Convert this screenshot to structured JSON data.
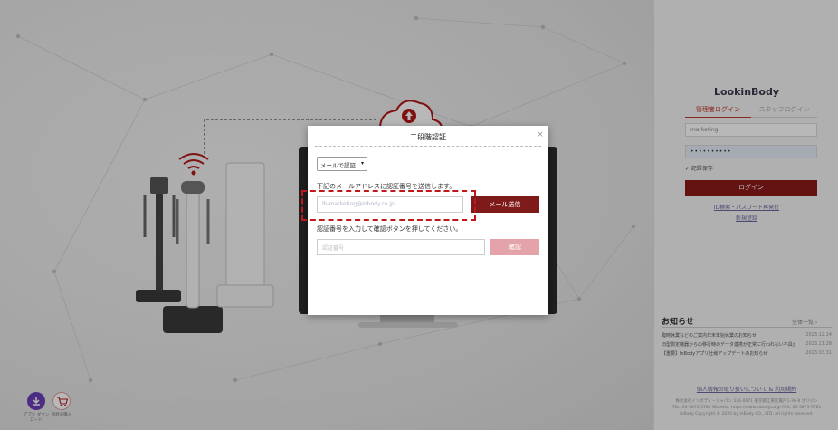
{
  "modal": {
    "title": "二段階認証",
    "close_symbol": "×",
    "method_select_value": "メールで認証",
    "method_chevron": "▾",
    "instruction_send": "下記のメールアドレスに認証番号を送信します。",
    "email_value": "lb-marketing@inbody.co.jp",
    "send_button": "メール送信",
    "instruction_code": "認証番号を入力して確認ボタンを押してください。",
    "code_placeholder": "認証番号",
    "confirm_button": "確認"
  },
  "login_panel": {
    "title": "LookinBody",
    "tab_member": "管理者ログイン",
    "tab_staff": "スタッフログイン",
    "id_value": "marketing",
    "password_value": "••••••••••",
    "remember_label": "✓ 記録保存",
    "login_button": "ログイン",
    "forgot_link": "ID検索・パスワード再発行",
    "signup_link": "新規登録"
  },
  "news": {
    "title": "お知らせ",
    "all_link": "全体一覧 ›",
    "items": [
      {
        "text": "臨時休業などのご案内年末年始休業のお知らせ",
        "date": "2023.12.14"
      },
      {
        "text": "旧型測定機器からの移行時のデータ連携が正常に行われない不具合の…",
        "date": "2023.11.28"
      },
      {
        "text": "【重要】InBodyアプリ仕様アップデートのお知らせ",
        "date": "2023.03.31"
      }
    ]
  },
  "footer": {
    "privacy_link": "個人情報の取り扱いについて & 利用規約",
    "company_line": "株式会社インボディ・ジャパン 136-0071 東京都江東区亀戸1-36-8 オリジン",
    "contact_line": "TEL: 03-5875-5780 Website: https://www.inbody.co.jp FAX: 03-5875-5781",
    "copyright": "InBody Copyright © 2020 by InBody CO., LTD. All rights reserved."
  },
  "floating": {
    "download_caption": "アプリ ダウンロード",
    "cart_caption": "消耗品購入"
  },
  "colors": {
    "accent_dark": "#7e1a1a",
    "accent_light": "#e3a3a8",
    "highlight": "#c01818",
    "download_button": "#6b3fb8"
  },
  "icons": [
    "close-icon",
    "chevron-down-icon",
    "download-icon",
    "cart-icon",
    "cloud-upload-icon",
    "wifi-icon",
    "checkmark-icon"
  ]
}
